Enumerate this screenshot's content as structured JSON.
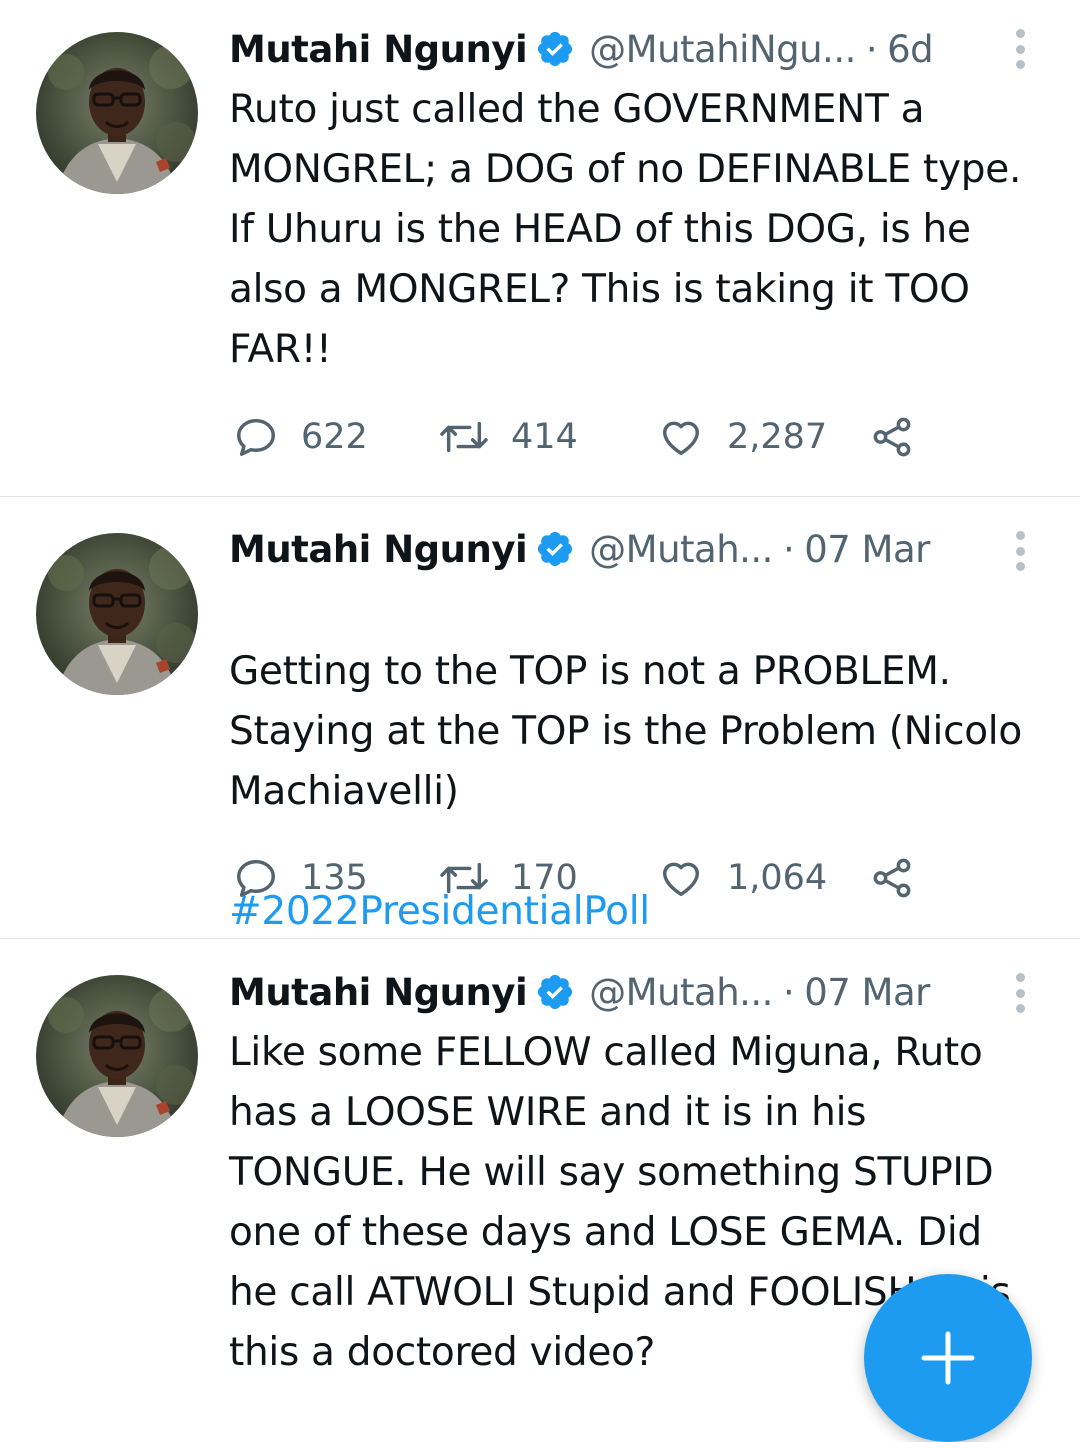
{
  "colors": {
    "accent": "#1d9bf0",
    "secondary_text": "#536471",
    "divider": "#e1e6ea"
  },
  "compose_button": {
    "icon": "plus-icon"
  },
  "tweets": [
    {
      "author_name": "Mutahi Ngunyi",
      "handle": "@MutahiNgu...",
      "time": "6d",
      "text": "Ruto just called the GOVERNMENT a MONGREL; a DOG of no DEFINABLE type. If Uhuru is the HEAD of this DOG, is he also a MONGREL? This is taking it TOO FAR!!",
      "hashtag": "",
      "replies": "622",
      "retweets": "414",
      "likes": "2,287"
    },
    {
      "author_name": "Mutahi Ngunyi",
      "handle": "@Mutah...",
      "time": "07 Mar",
      "text": "Getting to the TOP is not a PROBLEM. Staying at the TOP is the Problem (Nicolo Machiavelli)",
      "hashtag": "#2022PresidentialPoll",
      "replies": "135",
      "retweets": "170",
      "likes": "1,064"
    },
    {
      "author_name": "Mutahi Ngunyi",
      "handle": "@Mutah...",
      "time": "07 Mar",
      "text": "Like some FELLOW called Miguna, Ruto has a LOOSE WIRE and it is in his TONGUE. He will say something STUPID one of these days and LOSE GEMA. Did he call ATWOLI Stupid and FOOLISH or is this a doctored video?",
      "hashtag": ""
    }
  ]
}
